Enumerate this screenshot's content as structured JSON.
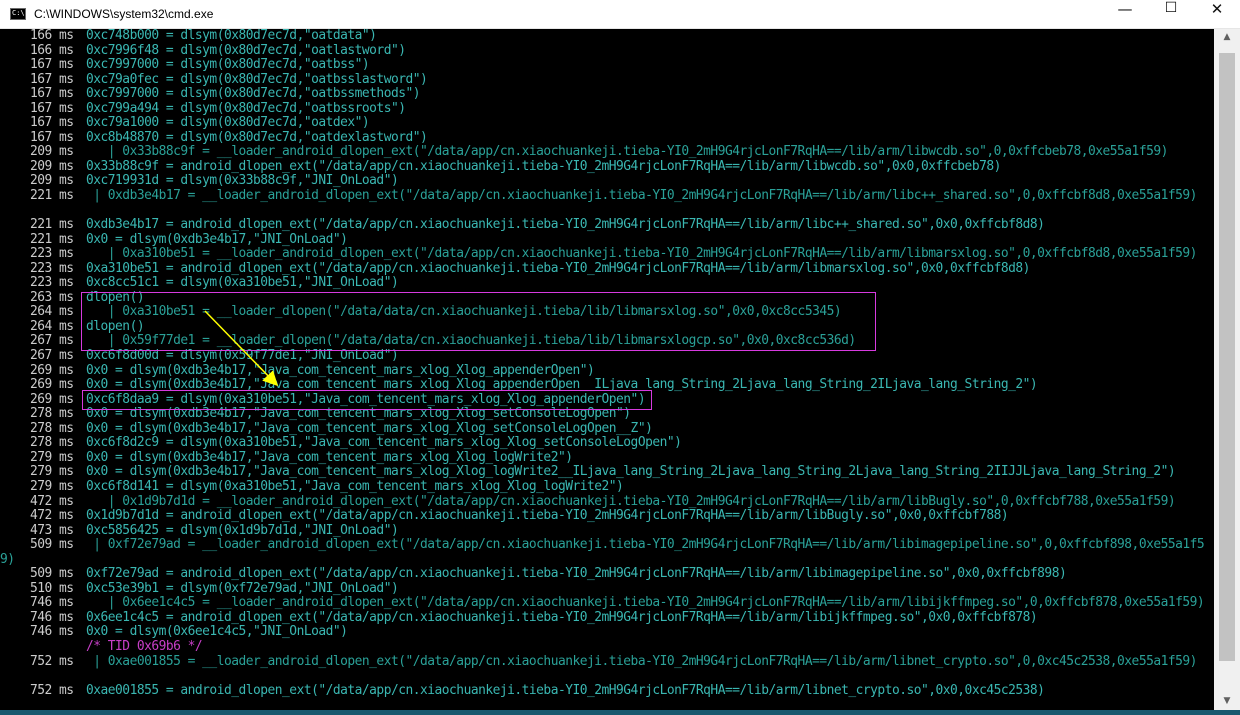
{
  "window": {
    "title": "C:\\WINDOWS\\system32\\cmd.exe",
    "icon_text": "C:\\",
    "minimize": "—",
    "maximize": "☐",
    "close": "✕"
  },
  "scrollbar": {
    "up": "▲",
    "down": "▼"
  },
  "console": {
    "lines": [
      {
        "ts": "166 ms",
        "text": "0xc748b000 = dlsym(0x80d7ec7d,\"oatdata\")",
        "color": "teal"
      },
      {
        "ts": "166 ms",
        "text": "0xc7996f48 = dlsym(0x80d7ec7d,\"oatlastword\")",
        "color": "teal"
      },
      {
        "ts": "167 ms",
        "text": "0xc7997000 = dlsym(0x80d7ec7d,\"oatbss\")",
        "color": "teal"
      },
      {
        "ts": "167 ms",
        "text": "0xc79a0fec = dlsym(0x80d7ec7d,\"oatbsslastword\")",
        "color": "teal"
      },
      {
        "ts": "167 ms",
        "text": "0xc7997000 = dlsym(0x80d7ec7d,\"oatbssmethods\")",
        "color": "teal"
      },
      {
        "ts": "167 ms",
        "text": "0xc799a494 = dlsym(0x80d7ec7d,\"oatbssroots\")",
        "color": "teal"
      },
      {
        "ts": "167 ms",
        "text": "0xc79a1000 = dlsym(0x80d7ec7d,\"oatdex\")",
        "color": "teal"
      },
      {
        "ts": "167 ms",
        "text": "0xc8b48870 = dlsym(0x80d7ec7d,\"oatdexlastword\")",
        "color": "teal"
      },
      {
        "ts": "209 ms",
        "text": "   | 0x33b88c9f = __loader_android_dlopen_ext(\"/data/app/cn.xiaochuankeji.tieba-YI0_2mH9G4rjcLonF7RqHA==/lib/arm/libwcdb.so\",0,0xffcbeb78,0xe55a1f59)",
        "color": "cyan"
      },
      {
        "ts": "209 ms",
        "text": "0x33b88c9f = android_dlopen_ext(\"/data/app/cn.xiaochuankeji.tieba-YI0_2mH9G4rjcLonF7RqHA==/lib/arm/libwcdb.so\",0x0,0xffcbeb78)",
        "color": "teal"
      },
      {
        "ts": "209 ms",
        "text": "0xc719931d = dlsym(0x33b88c9f,\"JNI_OnLoad\")",
        "color": "teal"
      },
      {
        "ts": "221 ms",
        "text": "   | 0xdb3e4b17 = __loader_android_dlopen_ext(\"/data/app/cn.xiaochuankeji.tieba-YI0_2mH9G4rjcLonF7RqHA==/lib/arm/libc++_shared.so\",0,0xffcbf8d8,0xe55a1f59)",
        "color": "cyan",
        "wrap": true
      },
      {
        "ts": "221 ms",
        "text": "0xdb3e4b17 = android_dlopen_ext(\"/data/app/cn.xiaochuankeji.tieba-YI0_2mH9G4rjcLonF7RqHA==/lib/arm/libc++_shared.so\",0x0,0xffcbf8d8)",
        "color": "teal"
      },
      {
        "ts": "221 ms",
        "text": "0x0 = dlsym(0xdb3e4b17,\"JNI_OnLoad\")",
        "color": "teal"
      },
      {
        "ts": "223 ms",
        "text": "   | 0xa310be51 = __loader_android_dlopen_ext(\"/data/app/cn.xiaochuankeji.tieba-YI0_2mH9G4rjcLonF7RqHA==/lib/arm/libmarsxlog.so\",0,0xffcbf8d8,0xe55a1f59)",
        "color": "cyan"
      },
      {
        "ts": "223 ms",
        "text": "0xa310be51 = android_dlopen_ext(\"/data/app/cn.xiaochuankeji.tieba-YI0_2mH9G4rjcLonF7RqHA==/lib/arm/libmarsxlog.so\",0x0,0xffcbf8d8)",
        "color": "teal"
      },
      {
        "ts": "223 ms",
        "text": "0xc8cc51c1 = dlsym(0xa310be51,\"JNI_OnLoad\")",
        "color": "teal"
      },
      {
        "ts": "263 ms",
        "text": "dlopen()",
        "color": "teal"
      },
      {
        "ts": "264 ms",
        "text": "   | 0xa310be51 = __loader_dlopen(\"/data/data/cn.xiaochuankeji.tieba/lib/libmarsxlog.so\",0x0,0xc8cc5345)",
        "color": "cyan"
      },
      {
        "ts": "264 ms",
        "text": "dlopen()",
        "color": "teal"
      },
      {
        "ts": "267 ms",
        "text": "   | 0x59f77de1 = __loader_dlopen(\"/data/data/cn.xiaochuankeji.tieba/lib/libmarsxlogcp.so\",0x0,0xc8cc536d)",
        "color": "cyan"
      },
      {
        "ts": "267 ms",
        "text": "0xc6f8d00d = dlsym(0x59f77de1,\"JNI_OnLoad\")",
        "color": "teal"
      },
      {
        "ts": "269 ms",
        "text": "0x0 = dlsym(0xdb3e4b17,\"Java_com_tencent_mars_xlog_Xlog_appenderOpen\")",
        "color": "teal"
      },
      {
        "ts": "269 ms",
        "text": "0x0 = dlsym(0xdb3e4b17,\"Java_com_tencent_mars_xlog_Xlog_appenderOpen__ILjava_lang_String_2Ljava_lang_String_2ILjava_lang_String_2\")",
        "color": "teal"
      },
      {
        "ts": "269 ms",
        "text": "0xc6f8daa9 = dlsym(0xa310be51,\"Java_com_tencent_mars_xlog_Xlog_appenderOpen\")",
        "color": "teal"
      },
      {
        "ts": "278 ms",
        "text": "0x0 = dlsym(0xdb3e4b17,\"Java_com_tencent_mars_xlog_Xlog_setConsoleLogOpen\")",
        "color": "teal"
      },
      {
        "ts": "278 ms",
        "text": "0x0 = dlsym(0xdb3e4b17,\"Java_com_tencent_mars_xlog_Xlog_setConsoleLogOpen__Z\")",
        "color": "teal"
      },
      {
        "ts": "278 ms",
        "text": "0xc6f8d2c9 = dlsym(0xa310be51,\"Java_com_tencent_mars_xlog_Xlog_setConsoleLogOpen\")",
        "color": "teal"
      },
      {
        "ts": "279 ms",
        "text": "0x0 = dlsym(0xdb3e4b17,\"Java_com_tencent_mars_xlog_Xlog_logWrite2\")",
        "color": "teal"
      },
      {
        "ts": "279 ms",
        "text": "0x0 = dlsym(0xdb3e4b17,\"Java_com_tencent_mars_xlog_Xlog_logWrite2__ILjava_lang_String_2Ljava_lang_String_2Ljava_lang_String_2IIJJLjava_lang_String_2\")",
        "color": "teal"
      },
      {
        "ts": "279 ms",
        "text": "0xc6f8d141 = dlsym(0xa310be51,\"Java_com_tencent_mars_xlog_Xlog_logWrite2\")",
        "color": "teal"
      },
      {
        "ts": "472 ms",
        "text": "   | 0x1d9b7d1d = __loader_android_dlopen_ext(\"/data/app/cn.xiaochuankeji.tieba-YI0_2mH9G4rjcLonF7RqHA==/lib/arm/libBugly.so\",0,0xffcbf788,0xe55a1f59)",
        "color": "cyan"
      },
      {
        "ts": "472 ms",
        "text": "0x1d9b7d1d = android_dlopen_ext(\"/data/app/cn.xiaochuankeji.tieba-YI0_2mH9G4rjcLonF7RqHA==/lib/arm/libBugly.so\",0x0,0xffcbf788)",
        "color": "teal"
      },
      {
        "ts": "473 ms",
        "text": "0xc5856425 = dlsym(0x1d9b7d1d,\"JNI_OnLoad\")",
        "color": "teal"
      },
      {
        "ts": "509 ms",
        "text": "   | 0xf72e79ad = __loader_android_dlopen_ext(\"/data/app/cn.xiaochuankeji.tieba-YI0_2mH9G4rjcLonF7RqHA==/lib/arm/libimagepipeline.so\",0,0xffcbf898,0xe55a1f59)",
        "color": "cyan",
        "wrap": true
      },
      {
        "ts": "509 ms",
        "text": "0xf72e79ad = android_dlopen_ext(\"/data/app/cn.xiaochuankeji.tieba-YI0_2mH9G4rjcLonF7RqHA==/lib/arm/libimagepipeline.so\",0x0,0xffcbf898)",
        "color": "teal"
      },
      {
        "ts": "510 ms",
        "text": "0xc53e39b1 = dlsym(0xf72e79ad,\"JNI_OnLoad\")",
        "color": "teal"
      },
      {
        "ts": "746 ms",
        "text": "   | 0x6ee1c4c5 = __loader_android_dlopen_ext(\"/data/app/cn.xiaochuankeji.tieba-YI0_2mH9G4rjcLonF7RqHA==/lib/arm/libijkffmpeg.so\",0,0xffcbf878,0xe55a1f59)",
        "color": "cyan"
      },
      {
        "ts": "746 ms",
        "text": "0x6ee1c4c5 = android_dlopen_ext(\"/data/app/cn.xiaochuankeji.tieba-YI0_2mH9G4rjcLonF7RqHA==/lib/arm/libijkffmpeg.so\",0x0,0xffcbf878)",
        "color": "teal"
      },
      {
        "ts": "746 ms",
        "text": "0x0 = dlsym(0x6ee1c4c5,\"JNI_OnLoad\")",
        "color": "teal"
      },
      {
        "ts": "",
        "text": "/* TID 0x69b6 */",
        "color": "mag"
      },
      {
        "ts": "752 ms",
        "text": "   | 0xae001855 = __loader_android_dlopen_ext(\"/data/app/cn.xiaochuankeji.tieba-YI0_2mH9G4rjcLonF7RqHA==/lib/arm/libnet_crypto.so\",0,0xc45c2538,0xe55a1f59)",
        "color": "cyan",
        "wrap": true
      },
      {
        "ts": "752 ms",
        "text": "0xae001855 = android_dlopen_ext(\"/data/app/cn.xiaochuankeji.tieba-YI0_2mH9G4rjcLonF7RqHA==/lib/arm/libnet_crypto.so\",0x0,0xc45c2538)",
        "color": "teal"
      }
    ]
  },
  "annotations": {
    "highlight_color": "#d63adf",
    "arrow_color": "#ffff00"
  }
}
